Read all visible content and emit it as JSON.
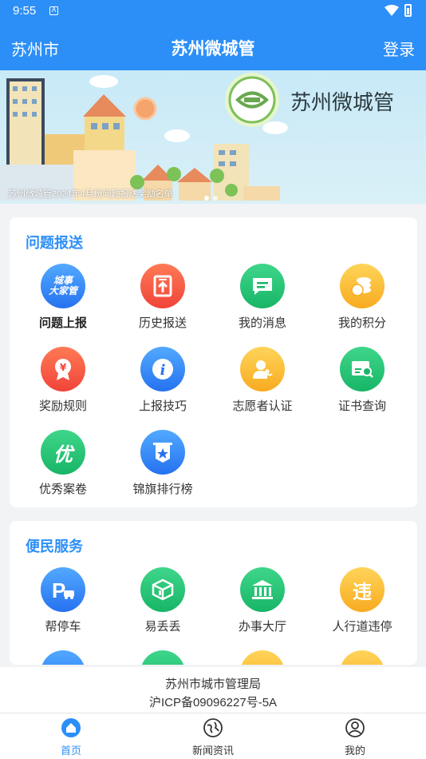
{
  "status_bar": {
    "time": "9:55",
    "sim_label": "A"
  },
  "app_bar": {
    "city": "苏州市",
    "title": "苏州微城管",
    "login": "登录"
  },
  "banner": {
    "brand": "苏州微城管",
    "caption": "苏州微城管2024年4月份问题报送奖励名单"
  },
  "report_section": {
    "title": "问题报送",
    "items": [
      {
        "label": "问题上报",
        "icon": "city-affairs-icon",
        "color": "blue",
        "glyph": "城事\n大家管"
      },
      {
        "label": "历史报送",
        "icon": "upload-history-icon",
        "color": "red"
      },
      {
        "label": "我的消息",
        "icon": "message-icon",
        "color": "green"
      },
      {
        "label": "我的积分",
        "icon": "coins-icon",
        "color": "yellow"
      },
      {
        "label": "奖励规则",
        "icon": "reward-medal-icon",
        "color": "red",
        "glyph": "¥"
      },
      {
        "label": "上报技巧",
        "icon": "info-icon",
        "color": "blue",
        "glyph": "i"
      },
      {
        "label": "志愿者认证",
        "icon": "volunteer-icon",
        "color": "yellow"
      },
      {
        "label": "证书查询",
        "icon": "certificate-search-icon",
        "color": "green"
      },
      {
        "label": "优秀案卷",
        "icon": "excellent-case-icon",
        "color": "green",
        "glyph": "优"
      },
      {
        "label": "锦旗排行榜",
        "icon": "banner-rank-icon",
        "color": "blue"
      }
    ]
  },
  "service_section": {
    "title": "便民服务",
    "items": [
      {
        "label": "帮停车",
        "icon": "parking-icon",
        "color": "blue",
        "glyph": "P"
      },
      {
        "label": "易丢丢",
        "icon": "recycle-box-icon",
        "color": "green"
      },
      {
        "label": "办事大厅",
        "icon": "government-hall-icon",
        "color": "green"
      },
      {
        "label": "人行道违停",
        "icon": "sidewalk-parking-icon",
        "color": "yellow",
        "glyph": "违"
      }
    ]
  },
  "footer": {
    "line1": "苏州市城市管理局",
    "line2": "沪ICP备09096227号-5A"
  },
  "tabs": [
    {
      "label": "首页",
      "icon": "home-icon",
      "active": true
    },
    {
      "label": "新闻资讯",
      "icon": "globe-icon",
      "active": false
    },
    {
      "label": "我的",
      "icon": "user-icon",
      "active": false
    }
  ],
  "colors": {
    "primary": "#2c8ff7",
    "blue": "#2672f0",
    "red": "#f0443a",
    "green": "#18b567",
    "yellow": "#f8ab20"
  }
}
